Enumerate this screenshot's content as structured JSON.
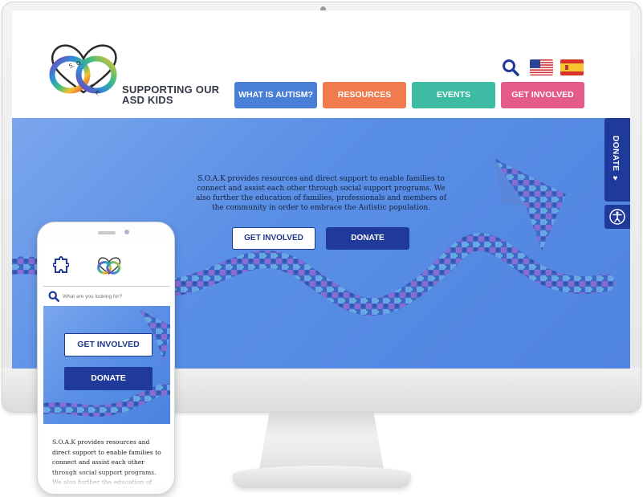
{
  "brand": {
    "logo_text": "S.O.A.K.",
    "name_line1": "SUPPORTING OUR",
    "name_line2": "ASD KIDS"
  },
  "header": {
    "nav": [
      {
        "label": "WHAT IS AUTISM?",
        "color": "#4a7fd8"
      },
      {
        "label": "RESOURCES",
        "color": "#f07b4f"
      },
      {
        "label": "EVENTS",
        "color": "#3dbba3"
      },
      {
        "label": "GET INVOLVED",
        "color": "#e35b86"
      }
    ],
    "icons": [
      "search-icon",
      "flag-us-icon",
      "flag-es-icon"
    ]
  },
  "hero": {
    "text": "S.O.A.K provides resources and direct support to enable families to connect and assist each other through social support programs. We also further the education of families, professionals and members of the community in order to embrace the Autistic population.",
    "get_involved": "GET INVOLVED",
    "donate": "DONATE"
  },
  "side_tabs": {
    "donate_label": "DONATE ♥",
    "accessibility_icon": "accessibility-icon"
  },
  "mobile": {
    "search_placeholder": "What are you looking for?",
    "get_involved": "GET INVOLVED",
    "donate": "DONATE",
    "text": "S.O.A.K provides resources and direct support to enable families to connect and assist each other through social support programs. We also further the education of"
  },
  "colors": {
    "primary_dark": "#1f3a9a",
    "hero_blue": "#5a8fe6",
    "text_dark": "#333b45"
  }
}
